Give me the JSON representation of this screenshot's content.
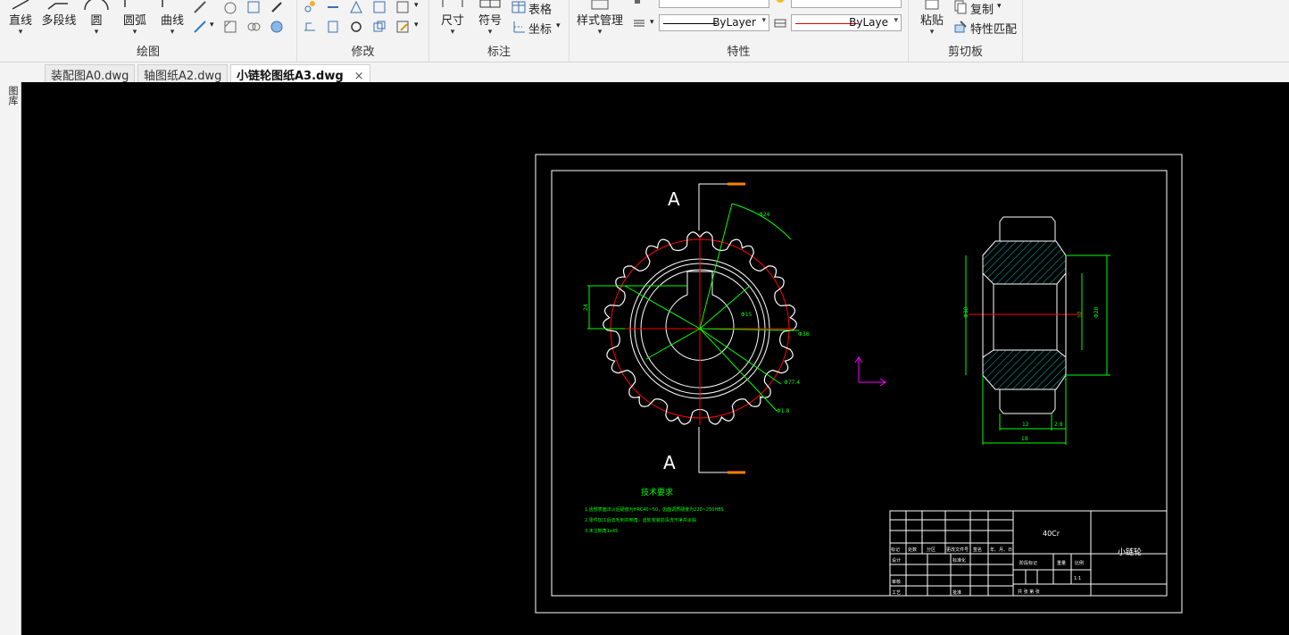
{
  "ribbon": {
    "draw": {
      "title": "绘图",
      "line_label": "直线",
      "polyline_label": "多段线",
      "circle_label": "圆",
      "arc_label": "圆弧",
      "curve_label": "曲线"
    },
    "modify": {
      "title": "修改"
    },
    "annotate": {
      "title": "标注",
      "dimension_label": "尺寸",
      "symbol_label": "符号",
      "table_label": "表格",
      "coord_label": "坐标"
    },
    "properties": {
      "title": "特性",
      "style_manager_label": "样式管理",
      "linetype_value": "ByLayer",
      "color_value": "ByLaye"
    },
    "clipboard": {
      "title": "剪切板",
      "paste_label": "粘贴",
      "copy_label": "复制",
      "match_label": "特性匹配"
    }
  },
  "tabs": [
    {
      "label": "装配图A0.dwg"
    },
    {
      "label": "轴图纸A2.dwg"
    },
    {
      "label": "小链轮图纸A3.dwg",
      "close": "×"
    }
  ],
  "side": {
    "label": "图库"
  },
  "drawing": {
    "section_mark_top": "A",
    "section_mark_bottom": "A",
    "tech_req_title": "技术要求",
    "tech_req_lines": [
      "1.齿部表面淬火后硬度为HRC40~50，齿面调质硬度为220~250HBS",
      "2.零件加工后去毛刺并倒角，齿轮安装前清洗干净并涂油",
      "3.未注倒角1x45"
    ],
    "title_block": {
      "material": "40Cr",
      "part_name": "小链轮",
      "header_cells": [
        "标记",
        "处数",
        "分区",
        "更改文件号",
        "签名",
        "年、月、日"
      ],
      "row_labels": [
        "设计",
        "审核",
        "工艺"
      ],
      "std_label": "标准化",
      "approve_label": "批准",
      "stage_label": "阶段标记",
      "weight_label": "重量",
      "scale_label": "比例",
      "sheet_info": "共 张 第 张",
      "scale_value": "1:1"
    },
    "dims": {
      "d1": "Φ38",
      "d2": "Φ24",
      "d3": "Φ15",
      "d4": "Φ77.4",
      "d5": "Φ1.8",
      "d6": "24",
      "w1": "12",
      "w2": "2.8",
      "w3": "18",
      "h1": "Φ38",
      "h2": "Φ28",
      "h3": "17"
    }
  },
  "colors": {
    "canvas_bg": "#000000",
    "frame": "#ffffff",
    "dim_green": "#00ff00",
    "center_red": "#ff0000",
    "hatch_cyan": "#00c0c0",
    "ucs_magenta": "#ff00ff",
    "leader_orange": "#ff8000"
  }
}
